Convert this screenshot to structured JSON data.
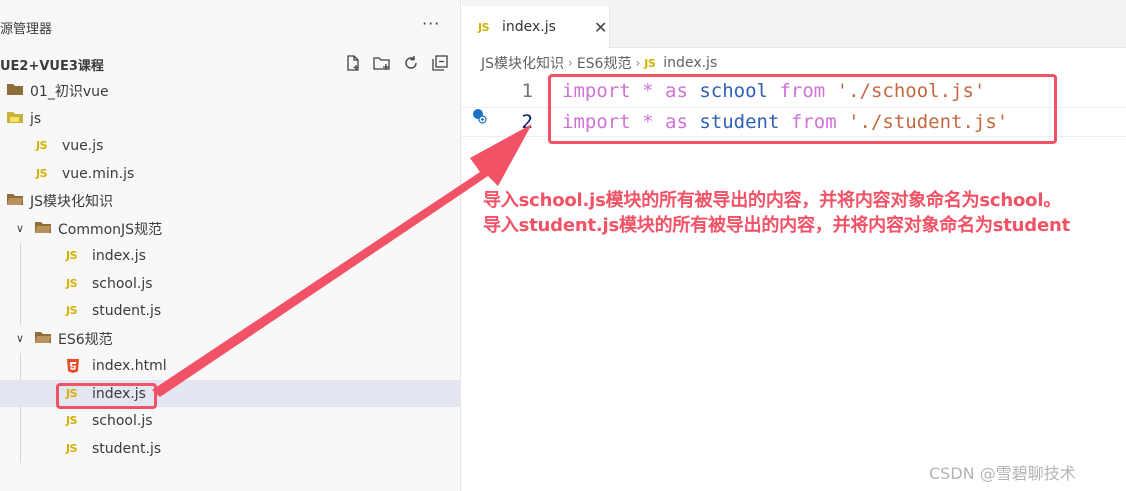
{
  "explorer": {
    "title": "源管理器",
    "more_label": "···",
    "project": "UE2+VUE3课程",
    "actions": [
      "new-file-icon",
      "new-folder-icon",
      "refresh-icon",
      "collapse-all-icon"
    ],
    "tree": [
      {
        "type": "folder",
        "name": "01_初识vue"
      },
      {
        "type": "folder",
        "name": "js"
      },
      {
        "type": "js",
        "name": "vue.js"
      },
      {
        "type": "js",
        "name": "vue.min.js"
      },
      {
        "type": "folder",
        "name": "JS模块化知识"
      },
      {
        "type": "folder",
        "name": "CommonJS规范"
      },
      {
        "type": "js",
        "name": "index.js"
      },
      {
        "type": "js",
        "name": "school.js"
      },
      {
        "type": "js",
        "name": "student.js"
      },
      {
        "type": "folder",
        "name": "ES6规范"
      },
      {
        "type": "html",
        "name": "index.html"
      },
      {
        "type": "js",
        "name": "index.js"
      },
      {
        "type": "js",
        "name": "school.js"
      },
      {
        "type": "js",
        "name": "student.js"
      }
    ],
    "js_badge": "JS",
    "chevron_open": "∨"
  },
  "editor": {
    "tab": {
      "icon": "JS",
      "name": "index.js",
      "close": "✕"
    },
    "breadcrumb": [
      "JS模块化知识",
      "ES6规范",
      "index.js"
    ],
    "breadcrumb_icon": "JS",
    "lines": [
      {
        "num": "1",
        "kw1": "import",
        "star": "*",
        "kw2": "as",
        "name": "school",
        "kw3": "from",
        "path": "'./school.js'"
      },
      {
        "num": "2",
        "kw1": "import",
        "star": "*",
        "kw2": "as",
        "name": "student",
        "kw3": "from",
        "path": "'./student.js'"
      }
    ]
  },
  "annotations": {
    "line1": "导入school.js模块的所有被导出的内容，并将内容对象命名为school。",
    "line2": "导入student.js模块的所有被导出的内容，并将内容对象命名为student"
  },
  "watermark": "CSDN @雪碧聊技术",
  "colors": {
    "highlight": "#f25266",
    "keyword": "#c586c0",
    "identifier": "#2f61b4",
    "string": "#c3683f",
    "selected_row": "#e4e6f1"
  }
}
